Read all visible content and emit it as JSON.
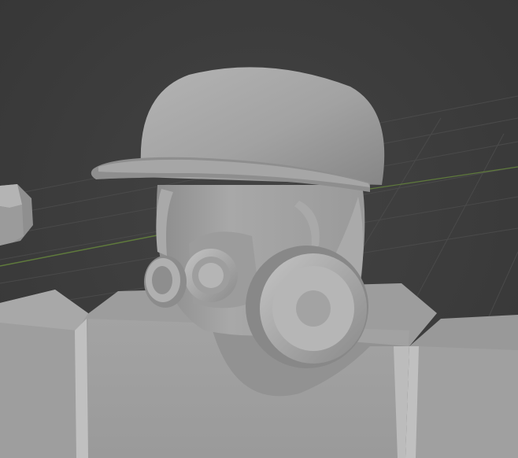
{
  "viewport": {
    "background_color": "#3d3d3d",
    "grid_color": "#4a4a4a",
    "x_axis_color": "#8a4a4a",
    "y_axis_color": "#5f7a3c",
    "model_base_color": "#9a9a9a"
  },
  "scene": {
    "objects": [
      "character-head",
      "cap",
      "gas-mask",
      "left-filter",
      "right-filter",
      "torso",
      "left-arm",
      "right-arm",
      "partial-object-left"
    ]
  }
}
